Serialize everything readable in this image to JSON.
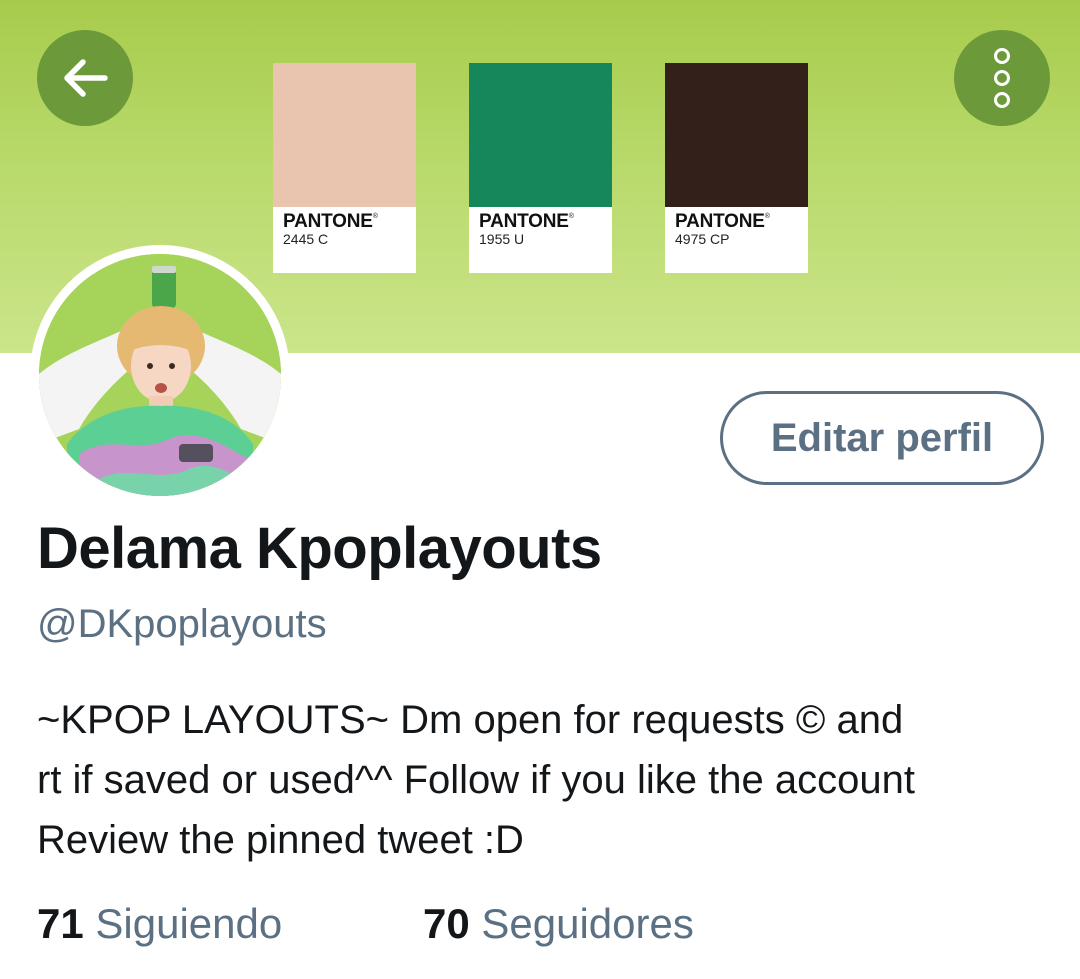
{
  "header": {
    "back_icon": "arrow-left-icon",
    "more_icon": "more-vertical-icon",
    "button_bg": "#6c9a3a"
  },
  "banner": {
    "background": "#b8d96a",
    "swatches": [
      {
        "brand": "PANTONE",
        "code": "2445 C",
        "color": "#e9c5af"
      },
      {
        "brand": "PANTONE",
        "code": "1955 U",
        "color": "#15875a"
      },
      {
        "brand": "PANTONE",
        "code": "4975 CP",
        "color": "#33201b"
      }
    ]
  },
  "profile": {
    "avatar_icon": "profile-avatar-icon",
    "edit_button": "Editar perfil",
    "name": "Delama Kpoplayouts",
    "handle": "@DKpoplayouts",
    "bio": [
      "~KPOP LAYOUTS~ Dm open for requests  © and",
      "rt if saved or used^^ Follow if you like the account",
      "Review the pinned tweet :D"
    ],
    "following_count": "71",
    "following_label": "Siguiendo",
    "followers_count": "70",
    "followers_label": "Seguidores"
  }
}
